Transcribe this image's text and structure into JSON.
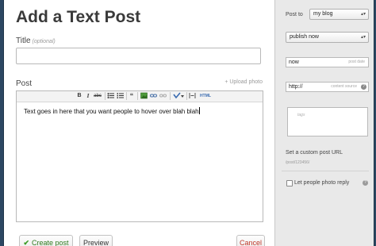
{
  "page_title": "Add a Text Post",
  "title_field": {
    "label": "Title",
    "hint": "(optional)",
    "value": ""
  },
  "post_field": {
    "label": "Post",
    "upload_link": "+ Upload photo",
    "body": "Text goes in here that you want people to hover over blah blah",
    "toolbar": {
      "bold": "B",
      "italic": "I",
      "strike": "abc",
      "quote": "“",
      "html": "HTML"
    }
  },
  "buttons": {
    "create": "Create post",
    "preview": "Preview",
    "cancel": "Cancel"
  },
  "sidebar": {
    "post_to_label": "Post to",
    "blog_selected": "my blog",
    "publish_selected": "publish now",
    "date_value": "now",
    "date_hint": "post date",
    "source_value": "http://",
    "source_hint": "content source",
    "tags_placeholder": "tags",
    "custom_url_label": "Set a custom post URL",
    "custom_url_hint": "/post/123456/",
    "photo_reply_label": "Let people photo reply"
  },
  "colors": {
    "background": "#2c4762",
    "accent_green": "#3c9a24",
    "cancel_red": "#c0392b"
  }
}
